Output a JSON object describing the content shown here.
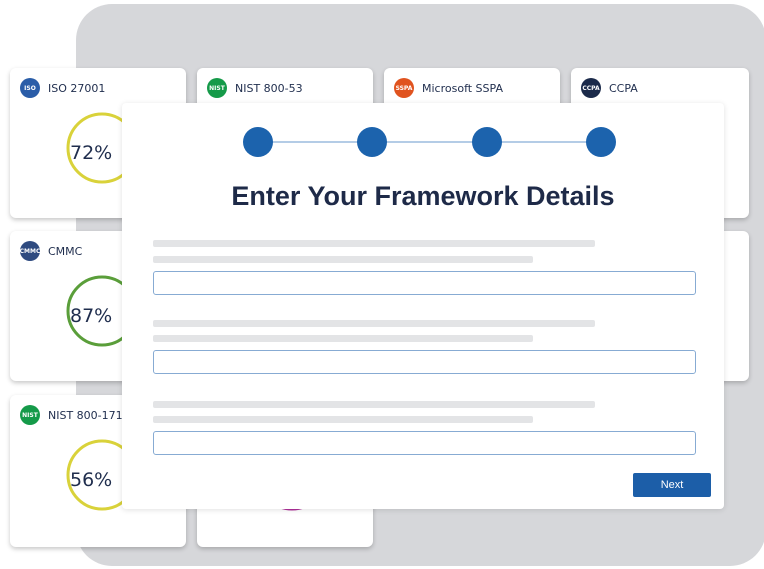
{
  "cards": [
    {
      "title": "ISO 27001",
      "logo_text": "ISO",
      "logo_icon": "iso-logo-icon",
      "logo_color": "#2a5da8"
    },
    {
      "title": "NIST 800-53",
      "logo_text": "NIST",
      "logo_icon": "nist-logo-icon",
      "logo_color": "#159a49"
    },
    {
      "title": "Microsoft SSPA",
      "logo_text": "SSPA",
      "logo_icon": "microsoft-logo-icon",
      "logo_color": "#e0531f"
    },
    {
      "title": "CCPA",
      "logo_text": "CCPA",
      "logo_icon": "lock-logo-icon",
      "logo_color": "#1b2a4a"
    },
    {
      "title": "CMMC",
      "logo_text": "CMMC",
      "logo_icon": "cmmc-logo-icon",
      "logo_color": "#2f4b80"
    },
    {
      "title": "NIST 800-171",
      "logo_text": "NIST",
      "logo_icon": "nist-logo-icon",
      "logo_color": "#159a49"
    }
  ],
  "gauges": [
    {
      "label": "72%",
      "value": 72,
      "color": "#d9d23a"
    },
    {
      "label": "87%",
      "value": 87,
      "color": "#5a9e3a"
    },
    {
      "label": "56%",
      "value": 56,
      "color": "#d9d23a"
    }
  ],
  "hidden_gauge_color": "#b0309a",
  "modal": {
    "title": "Enter Your Framework Details",
    "steps": 4,
    "step_color": "#1c63ad",
    "fields": [
      {
        "value": "",
        "placeholder": ""
      },
      {
        "value": "",
        "placeholder": ""
      },
      {
        "value": "",
        "placeholder": ""
      }
    ],
    "next_label": "Next"
  }
}
